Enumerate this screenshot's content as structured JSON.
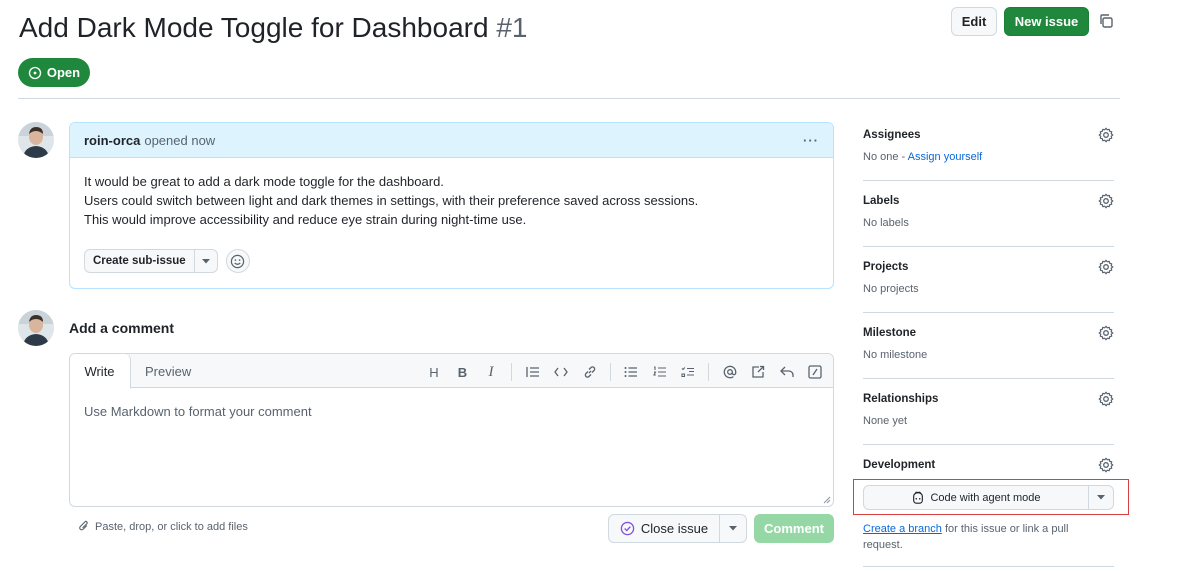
{
  "issue": {
    "title": "Add Dark Mode Toggle for Dashboard",
    "number": "#1",
    "status": "Open"
  },
  "header": {
    "edit_label": "Edit",
    "new_issue_label": "New issue"
  },
  "comment": {
    "author": "roin-orca",
    "meta": "opened now",
    "body_lines": [
      "It would be great to add a dark mode toggle for the dashboard.",
      "Users could switch between light and dark themes in settings, with their preference saved across sessions.",
      "This would improve accessibility and reduce eye strain during night-time use."
    ],
    "create_sub_issue_label": "Create sub-issue"
  },
  "new_comment": {
    "heading": "Add a comment",
    "tabs": [
      "Write",
      "Preview"
    ],
    "active_tab": "Write",
    "placeholder": "Use Markdown to format your comment",
    "paste_hint": "Paste, drop, or click to add files",
    "close_issue_label": "Close issue",
    "comment_label": "Comment",
    "toolbar_icons": [
      "heading-icon",
      "bold-icon",
      "italic-icon",
      "quote-icon",
      "code-icon",
      "link-icon",
      "unordered-list-icon",
      "ordered-list-icon",
      "task-list-icon",
      "mention-icon",
      "reference-icon",
      "reply-icon",
      "slash-command-icon"
    ]
  },
  "sidebar": {
    "assignees": {
      "label": "Assignees",
      "value_prefix": "No one - ",
      "assign_link": "Assign yourself"
    },
    "labels": {
      "label": "Labels",
      "value": "No labels"
    },
    "projects": {
      "label": "Projects",
      "value": "No projects"
    },
    "milestone": {
      "label": "Milestone",
      "value": "No milestone"
    },
    "relationships": {
      "label": "Relationships",
      "value": "None yet"
    },
    "development": {
      "label": "Development",
      "agent_button": "Code with agent mode",
      "create_branch_link": "Create a branch",
      "branch_text": " for this issue or link a pull request."
    }
  },
  "colors": {
    "open_green": "#1f883d",
    "link_blue": "#0969da",
    "highlight_red": "#d93f3f",
    "comment_header_bg": "#ddf4ff"
  }
}
